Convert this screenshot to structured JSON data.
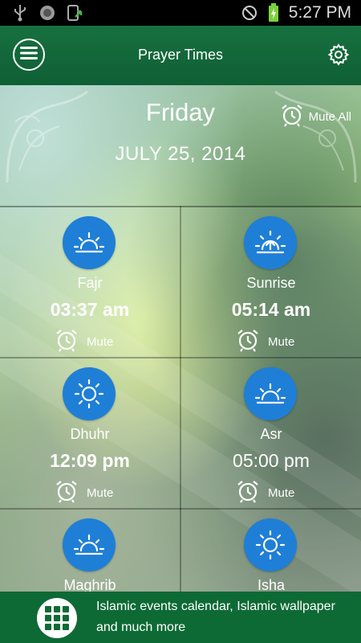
{
  "status_bar": {
    "time": "5:27 PM",
    "icons": [
      "usb-icon",
      "android-debug-icon",
      "download-icon",
      "no-signal-icon",
      "battery-charging-icon"
    ]
  },
  "app_bar": {
    "title": "Prayer Times",
    "menu_icon": "menu-icon",
    "settings_icon": "gear-icon"
  },
  "date_header": {
    "day": "Friday",
    "date": "JULY 25, 2014",
    "mute_all_label": "Mute All"
  },
  "prayers": [
    {
      "name": "Fajr",
      "time": "03:37 am",
      "mute_label": "Mute",
      "icon": "sunrise-icon"
    },
    {
      "name": "Sunrise",
      "time": "05:14 am",
      "mute_label": "Mute",
      "icon": "sunrise-arrow-icon"
    },
    {
      "name": "Dhuhr",
      "time": "12:09 pm",
      "mute_label": "Mute",
      "icon": "sun-icon"
    },
    {
      "name": "Asr",
      "time": "05:00 pm",
      "mute_label": "Mute",
      "icon": "sunset-icon"
    },
    {
      "name": "Maghrib",
      "time": "",
      "mute_label": "",
      "icon": "sunset-icon"
    },
    {
      "name": "Isha",
      "time": "",
      "mute_label": "",
      "icon": "sun-icon"
    }
  ],
  "banner": {
    "text": "Islamic events calendar, Islamic wallpaper and much more",
    "icon": "grid-apps-icon"
  },
  "colors": {
    "primary_green": "#0f5f35",
    "icon_blue": "#1f7fd6",
    "status_bar": "#000000"
  }
}
